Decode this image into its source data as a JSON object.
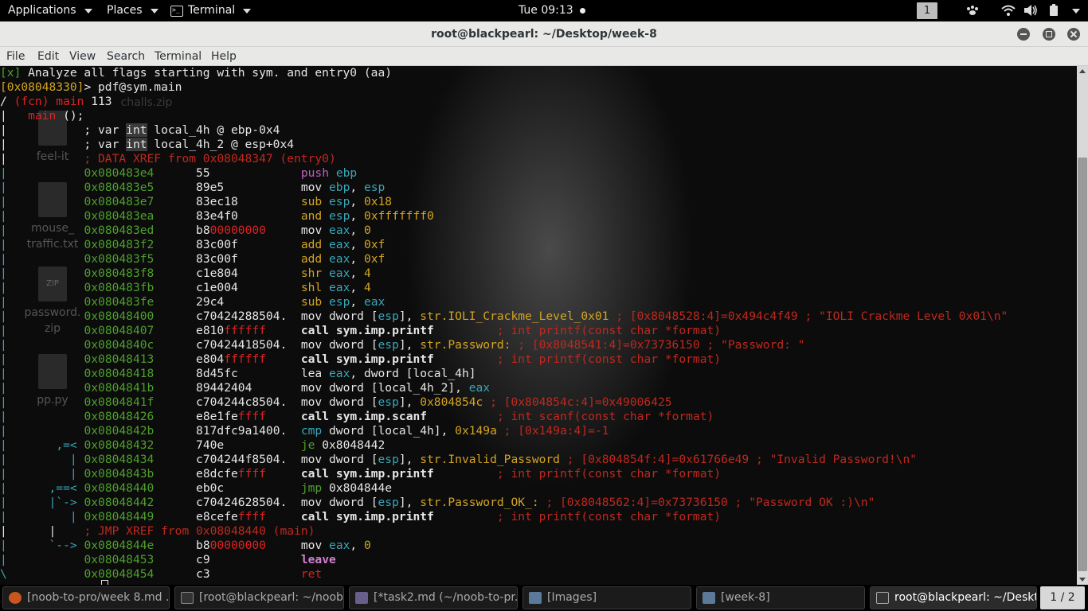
{
  "topbar": {
    "applications": "Applications",
    "places": "Places",
    "terminal": "Terminal",
    "clock": "Tue 09:13",
    "workspace": "1"
  },
  "window": {
    "title": "root@blackpearl: ~/Desktop/week-8"
  },
  "menu": [
    "File",
    "Edit",
    "View",
    "Search",
    "Terminal",
    "Help"
  ],
  "desktop_icons": [
    {
      "label": "challs.zip"
    },
    {
      "label": "feel-it"
    },
    {
      "label": "mouse_\ntraffic.txt"
    },
    {
      "label": "password.\nzip"
    },
    {
      "label": "pp.py"
    }
  ],
  "terminal": {
    "lines": [
      {
        "raw": "[x] Analyze all flags starting with sym. and entry0 (aa)"
      },
      {
        "raw": "[0x08048330]> pdf@sym.main"
      },
      {
        "raw": "/ (fcn) main 113"
      },
      {
        "raw": "|   main ();"
      },
      {
        "raw": "|           ; var int local_4h @ ebp-0x4"
      },
      {
        "raw": "|           ; var int local_4h_2 @ esp+0x4"
      },
      {
        "raw": "|           ; DATA XREF from 0x08048347 (entry0)"
      },
      {
        "addr": "0x080483e4",
        "bytes": "55",
        "op": "push ebp"
      },
      {
        "addr": "0x080483e5",
        "bytes": "89e5",
        "op": "mov ebp, esp"
      },
      {
        "addr": "0x080483e7",
        "bytes": "83ec18",
        "op": "sub esp, 0x18"
      },
      {
        "addr": "0x080483ea",
        "bytes": "83e4f0",
        "op": "and esp, 0xfffffff0"
      },
      {
        "addr": "0x080483ed",
        "bytes": "b800000000",
        "op": "mov eax, 0"
      },
      {
        "addr": "0x080483f2",
        "bytes": "83c00f",
        "op": "add eax, 0xf"
      },
      {
        "addr": "0x080483f5",
        "bytes": "83c00f",
        "op": "add eax, 0xf"
      },
      {
        "addr": "0x080483f8",
        "bytes": "c1e804",
        "op": "shr eax, 4"
      },
      {
        "addr": "0x080483fb",
        "bytes": "c1e004",
        "op": "shl eax, 4"
      },
      {
        "addr": "0x080483fe",
        "bytes": "29c4",
        "op": "sub esp, eax"
      },
      {
        "addr": "0x08048400",
        "bytes": "c70424288504.",
        "op": "mov dword [esp], str.IOLI_Crackme_Level_0x01",
        "comment": "; [0x8048528:4]=0x494c4f49 ; \"IOLI Crackme Level 0x01\\n\""
      },
      {
        "addr": "0x08048407",
        "bytes": "e810ffffff",
        "op": "call sym.imp.printf",
        "comment": "; int printf(const char *format)"
      },
      {
        "addr": "0x0804840c",
        "bytes": "c70424418504.",
        "op": "mov dword [esp], str.Password:",
        "comment": "; [0x8048541:4]=0x73736150 ; \"Password: \""
      },
      {
        "addr": "0x08048413",
        "bytes": "e804ffffff",
        "op": "call sym.imp.printf",
        "comment": "; int printf(const char *format)"
      },
      {
        "addr": "0x08048418",
        "bytes": "8d45fc",
        "op": "lea eax, dword [local_4h]"
      },
      {
        "addr": "0x0804841b",
        "bytes": "89442404",
        "op": "mov dword [local_4h_2], eax"
      },
      {
        "addr": "0x0804841f",
        "bytes": "c704244c8504.",
        "op": "mov dword [esp], 0x804854c",
        "comment": "; [0x804854c:4]=0x49006425"
      },
      {
        "addr": "0x08048426",
        "bytes": "e8e1feffff",
        "op": "call sym.imp.scanf",
        "comment": "; int scanf(const char *format)"
      },
      {
        "addr": "0x0804842b",
        "bytes": "817dfc9a1400.",
        "op": "cmp dword [local_4h], 0x149a",
        "comment": "; [0x149a:4]=-1"
      },
      {
        "prefix": ",=<",
        "addr": "0x08048432",
        "bytes": "740e",
        "op": "je 0x8048442"
      },
      {
        "prefix": "|",
        "addr": "0x08048434",
        "bytes": "c704244f8504.",
        "op": "mov dword [esp], str.Invalid_Password",
        "comment": "; [0x804854f:4]=0x61766e49 ; \"Invalid Password!\\n\""
      },
      {
        "prefix": "|",
        "addr": "0x0804843b",
        "bytes": "e8dcfeffff",
        "op": "call sym.imp.printf",
        "comment": "; int printf(const char *format)"
      },
      {
        "prefix": ",==<",
        "addr": "0x08048440",
        "bytes": "eb0c",
        "op": "jmp 0x804844e"
      },
      {
        "prefix": "|`->",
        "addr": "0x08048442",
        "bytes": "c70424628504.",
        "op": "mov dword [esp], str.Password_OK_:",
        "comment": "; [0x8048562:4]=0x73736150 ; \"Password OK :)\\n\""
      },
      {
        "prefix": "|",
        "addr": "0x08048449",
        "bytes": "e8cefeffff",
        "op": "call sym.imp.printf",
        "comment": "; int printf(const char *format)"
      },
      {
        "raw": "|      |    ; JMP XREF from 0x08048440 (main)"
      },
      {
        "prefix": "`-->",
        "addr": "0x0804844e",
        "bytes": "b800000000",
        "op": "mov eax, 0"
      },
      {
        "addr": "0x08048453",
        "bytes": "c9",
        "op": "leave"
      },
      {
        "addr": "0x08048454",
        "bytes": "c3",
        "op": "ret"
      }
    ]
  },
  "taskbar": {
    "tasks": [
      {
        "label": "[noob-to-pro/week 8.md ..."
      },
      {
        "label": "[root@blackpearl: ~/noob..."
      },
      {
        "label": "[*task2.md (~/noob-to-pr..."
      },
      {
        "label": "[Images]"
      },
      {
        "label": "[week-8]"
      },
      {
        "label": "root@blackpearl: ~/Deskt..."
      }
    ],
    "pager": "1 / 2"
  },
  "colors": {
    "address": "#4ea02c",
    "comment": "#c0281e",
    "register": "#38a6b8",
    "immediate": "#d4a520",
    "call": "#e6e6e6"
  }
}
